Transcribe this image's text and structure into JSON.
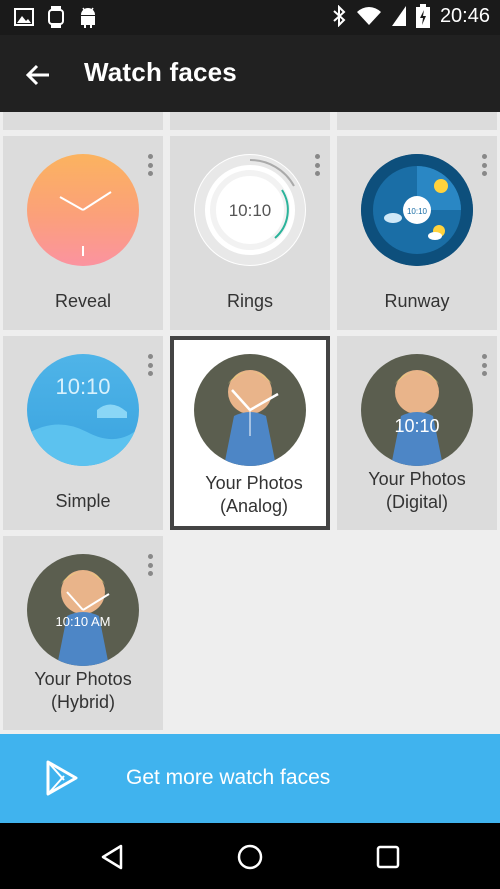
{
  "status_bar": {
    "time": "20:46",
    "left_icons": [
      "image-icon",
      "watch-icon",
      "android-icon"
    ],
    "right_icons": [
      "bluetooth-icon",
      "wifi-icon",
      "battery-charging-icon"
    ]
  },
  "app_bar": {
    "title": "Watch faces",
    "back_icon": "arrow-back-icon"
  },
  "faces": [
    {
      "name": "Reveal",
      "time_text": ""
    },
    {
      "name": "Rings",
      "time_text": "10:10"
    },
    {
      "name": "Runway",
      "time_text": "10:10"
    },
    {
      "name": "Simple",
      "time_text": "10:10"
    },
    {
      "name": "Your Photos\n(Analog)",
      "line1": "Your Photos",
      "line2": "(Analog)",
      "selected": true
    },
    {
      "name": "Your Photos\n(Digital)",
      "line1": "Your Photos",
      "line2": "(Digital)",
      "time_text": "10:10"
    },
    {
      "name": "Your Photos\n(Hybrid)",
      "line1": "Your Photos",
      "line2": "(Hybrid)",
      "time_text": "10:10 AM"
    }
  ],
  "cta": {
    "label": "Get more watch faces",
    "icon": "play-store-icon"
  },
  "colors": {
    "accent": "#40b3ee",
    "app_bar": "#212121",
    "tile_bg": "#dcdcdc"
  }
}
